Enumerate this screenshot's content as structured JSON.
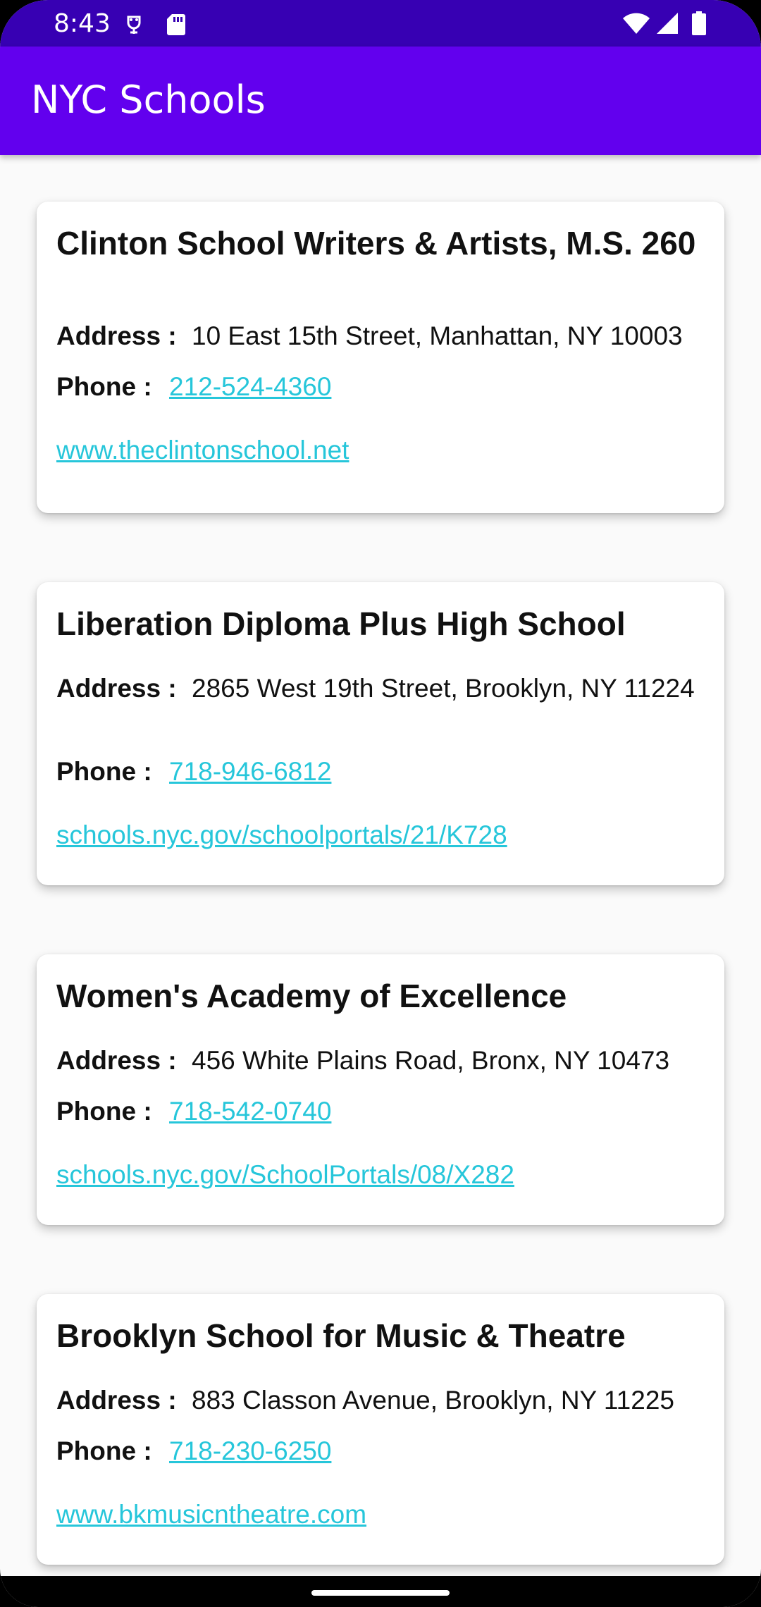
{
  "status_bar": {
    "time": "8:43",
    "icons": [
      "usb-debug-icon",
      "sd-card-icon",
      "wifi-icon",
      "cellular-signal-icon",
      "battery-icon"
    ]
  },
  "app_bar": {
    "title": "NYC Schools"
  },
  "labels": {
    "address": "Address :",
    "phone": "Phone :"
  },
  "schools": [
    {
      "name": "Clinton School Writers & Artists, M.S. 260",
      "address": "10 East 15th Street, Manhattan, NY 10003",
      "phone": "212-524-4360",
      "website": "www.theclintonschool.net"
    },
    {
      "name": "Liberation Diploma Plus High School",
      "address": "2865 West 19th Street, Brooklyn, NY 11224",
      "phone": "718-946-6812",
      "website": "schools.nyc.gov/schoolportals/21/K728"
    },
    {
      "name": "Women's Academy of Excellence",
      "address": "456 White Plains Road, Bronx, NY 10473",
      "phone": "718-542-0740",
      "website": "schools.nyc.gov/SchoolPortals/08/X282"
    },
    {
      "name": "Brooklyn School for Music & Theatre",
      "address": "883 Classon Avenue, Brooklyn, NY 11225",
      "phone": "718-230-6250",
      "website": "www.bkmusicntheatre.com"
    }
  ],
  "colors": {
    "status_bar": "#3700b3",
    "app_bar": "#6200ee",
    "link": "#26c6da"
  }
}
